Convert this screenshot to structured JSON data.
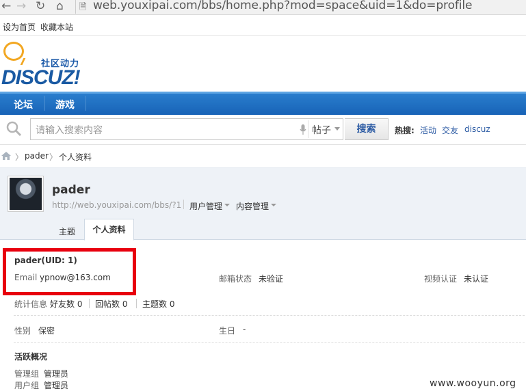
{
  "browser": {
    "back_icon": "arrow-left-icon",
    "forward_icon": "arrow-right-icon",
    "reload_icon": "reload-icon",
    "home_icon": "home-icon",
    "page_icon": "page-icon",
    "url": "web.youxipai.com/bbs/home.php?mod=space&uid=1&do=profile"
  },
  "toplinks": {
    "set_home": "设为首页",
    "bookmark": "收藏本站"
  },
  "logo": {
    "tagline": "社区动力",
    "word": "DISCUZ!"
  },
  "nav": {
    "forum": "论坛",
    "games": "游戏"
  },
  "search": {
    "placeholder": "请输入搜索内容",
    "type": "帖子",
    "button": "搜索",
    "hot_label": "热搜:",
    "hot_links": [
      "活动",
      "交友",
      "discuz"
    ]
  },
  "breadcrumb": {
    "user": "pader",
    "page": "个人资料"
  },
  "profile": {
    "name": "pader",
    "url": "http://web.youxipai.com/bbs/?1",
    "user_manage": "用户管理",
    "content_manage": "内容管理",
    "tabs": {
      "topics": "主题",
      "profile": "个人资料"
    }
  },
  "info": {
    "name_uid": "pader(UID: 1)",
    "email_label": "Email",
    "email_value": "ypnow@163.com",
    "mail_status_label": "邮箱状态",
    "mail_status_value": "未验证",
    "video_label": "视频认证",
    "video_value": "未认证",
    "stats_label": "统计信息",
    "friends": "好友数 0",
    "replies": "回帖数 0",
    "threads": "主题数 0",
    "gender_label": "性别",
    "gender_value": "保密",
    "birthday_label": "生日",
    "birthday_value": "-",
    "activity_title": "活跃概况",
    "admin_group_label": "管理组",
    "admin_group_value": "管理员",
    "user_group_label": "用户组",
    "user_group_value": "管理员"
  },
  "watermark": "www.wooyun.org",
  "colors": {
    "nav_blue": "#1e6bbf",
    "highlight_red": "#e8000e",
    "link_blue": "#2b5aa3"
  }
}
